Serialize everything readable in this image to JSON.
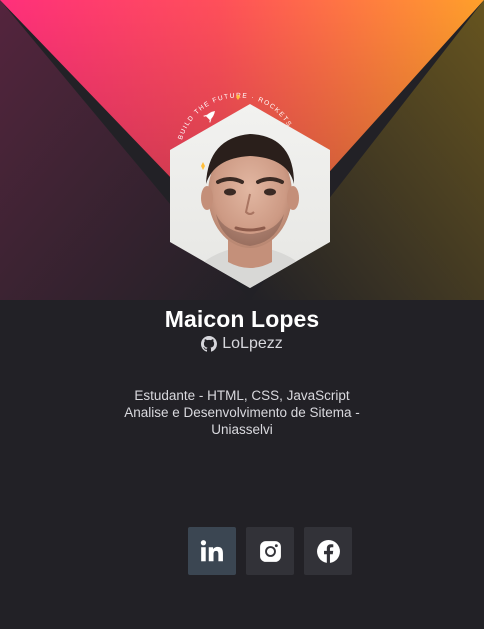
{
  "profile": {
    "name": "Maicon Lopes",
    "github_username": "LoLpezz",
    "badge_text": "BUILD THE FUTURE · ROCKETSEAT",
    "bio_lines": [
      "Estudante - HTML, CSS, JavaScript",
      "Analise e Desenvolvimento de Sitema -",
      "Uniasselvi"
    ]
  },
  "social": [
    {
      "name": "linkedin",
      "icon": "linkedin-icon",
      "active": true
    },
    {
      "name": "instagram",
      "icon": "instagram-icon",
      "active": false
    },
    {
      "name": "facebook",
      "icon": "facebook-icon",
      "active": false
    }
  ],
  "colors": {
    "background": "#222126",
    "gradient_start": "#ff2b7a",
    "gradient_end": "#ff9f2b",
    "text": "#ffffff",
    "muted_text": "#d7d7dc",
    "social_button": "#323238",
    "social_button_active": "#3b4652"
  }
}
